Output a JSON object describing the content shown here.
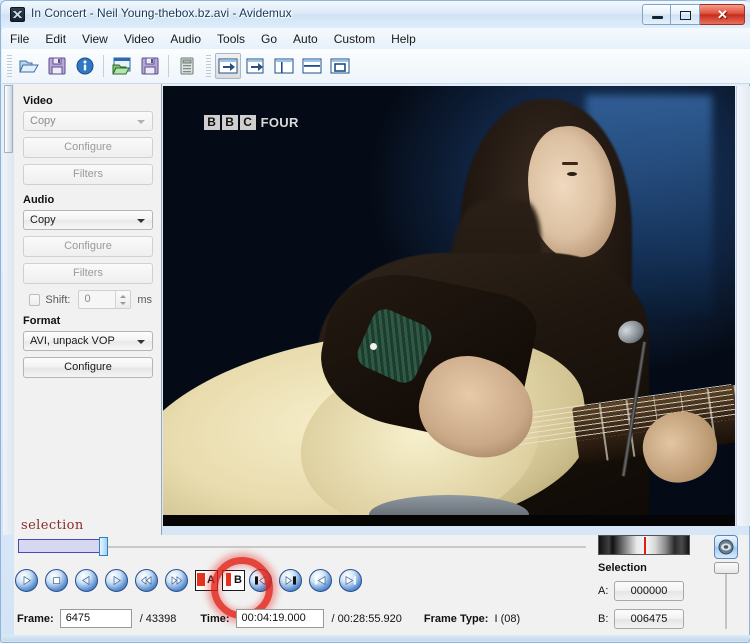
{
  "window": {
    "title": "In Concert - Neil Young-thebox.bz.avi - Avidemux",
    "app_icon": "avidemux-icon",
    "minimize_label": "",
    "maximize_label": "",
    "close_label": "✕"
  },
  "menu": {
    "items": [
      {
        "label": "File",
        "name": "menu-file"
      },
      {
        "label": "Edit",
        "name": "menu-edit"
      },
      {
        "label": "View",
        "name": "menu-view"
      },
      {
        "label": "Video",
        "name": "menu-video"
      },
      {
        "label": "Audio",
        "name": "menu-audio"
      },
      {
        "label": "Tools",
        "name": "menu-tools"
      },
      {
        "label": "Go",
        "name": "menu-go"
      },
      {
        "label": "Auto",
        "name": "menu-auto"
      },
      {
        "label": "Custom",
        "name": "menu-custom"
      },
      {
        "label": "Help",
        "name": "menu-help"
      }
    ]
  },
  "toolbar": {
    "buttons": [
      {
        "name": "open-file-icon",
        "title": "Open"
      },
      {
        "name": "save-file-icon",
        "title": "Save"
      },
      {
        "name": "info-icon",
        "title": "Properties"
      },
      {
        "name": "open-video-icon",
        "title": "Open video"
      },
      {
        "name": "save-video-icon",
        "title": "Save video"
      },
      {
        "name": "calculator-icon",
        "title": "Calculator"
      },
      {
        "name": "goto-marker-a-icon",
        "title": "Go to marker A"
      },
      {
        "name": "goto-marker-b-icon",
        "title": "Go to marker B"
      },
      {
        "name": "split-vertical-icon",
        "title": "Split vertical"
      },
      {
        "name": "split-horizontal-icon",
        "title": "Split horizontal"
      },
      {
        "name": "single-view-icon",
        "title": "Single view"
      }
    ]
  },
  "sidebar": {
    "video": {
      "heading": "Video",
      "codec_value": "Copy",
      "configure_label": "Configure",
      "filters_label": "Filters"
    },
    "audio": {
      "heading": "Audio",
      "codec_value": "Copy",
      "configure_label": "Configure",
      "filters_label": "Filters",
      "shift_label": "Shift:",
      "shift_value": "0",
      "shift_units": "ms"
    },
    "format": {
      "heading": "Format",
      "container_value": "AVI, unpack VOP",
      "configure_label": "Configure"
    }
  },
  "video_preview": {
    "watermark_blocks": [
      "B",
      "B",
      "C"
    ],
    "watermark_word": "FOUR",
    "description": "Neil Young playing acoustic guitar on BBC Four In Concert"
  },
  "timeline": {
    "selection_caption": "selection",
    "selection_start_pct": 0,
    "selection_end_pct": 15,
    "playhead_pct": 15
  },
  "transport": {
    "buttons": [
      {
        "name": "play-button",
        "glyph": "▶"
      },
      {
        "name": "stop-button",
        "glyph": "■"
      },
      {
        "name": "step-back-button",
        "glyph": "◀"
      },
      {
        "name": "step-forward-button",
        "glyph": "▶"
      },
      {
        "name": "prev-keyframe-button",
        "glyph": "◀◀"
      },
      {
        "name": "next-keyframe-button",
        "glyph": "▶▶"
      },
      {
        "name": "set-marker-a-button",
        "glyph": "A"
      },
      {
        "name": "set-marker-b-button",
        "glyph": "B"
      },
      {
        "name": "goto-prev-black-frame-button",
        "glyph": "◀|"
      },
      {
        "name": "goto-next-black-frame-button",
        "glyph": "|▶"
      },
      {
        "name": "goto-start-button",
        "glyph": "◀◀|"
      },
      {
        "name": "goto-end-button",
        "glyph": "|▶▶"
      }
    ],
    "highlight_annotation": "red-circle-highlight"
  },
  "status": {
    "frame_label": "Frame:",
    "frame_value": "6475",
    "frame_total": "/ 43398",
    "time_label": "Time:",
    "time_value": "00:04:19.000",
    "time_total": "/ 00:28:55.920",
    "frame_type_label": "Frame Type:",
    "frame_type_value": "I (08)"
  },
  "selection_panel": {
    "heading": "Selection",
    "a_label": "A:",
    "a_value": "000000",
    "b_label": "B:",
    "b_value": "006475",
    "volume_icon": "speaker-icon"
  },
  "colors": {
    "accent_red": "#e21e14",
    "selection_caption": "#8a2b2b",
    "titlebar_text": "#15395b",
    "panel_bg": "#f1f1f1"
  }
}
